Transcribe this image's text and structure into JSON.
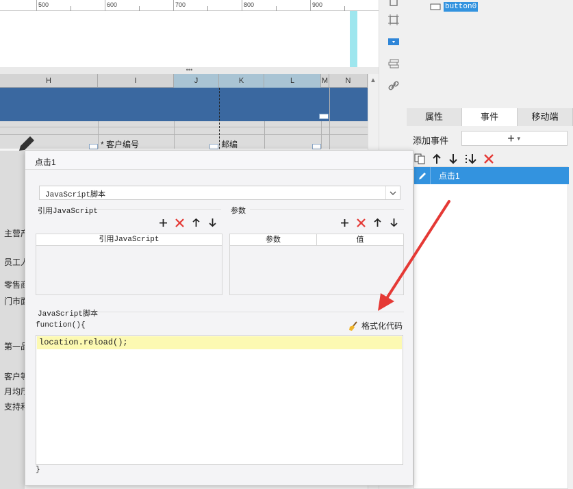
{
  "ruler": {
    "ticks": [
      "500",
      "600",
      "700",
      "800",
      "900"
    ]
  },
  "grid": {
    "columns": [
      "H",
      "I",
      "J",
      "K",
      "L",
      "M",
      "N"
    ],
    "cells": {
      "customer_no": "* 客户编号",
      "postcode": "邮编"
    },
    "row_labels": [
      "主营产",
      "员工人",
      "零售商",
      "门市面",
      "第一品",
      "客户等",
      "月均厅",
      "支持和"
    ]
  },
  "component_tree": {
    "item_label": "button0"
  },
  "panel_tabs": [
    "属性",
    "事件",
    "移动端"
  ],
  "events": {
    "add_label": "添加事件",
    "add_button_symbol": "+",
    "items": [
      "点击1"
    ]
  },
  "dialog": {
    "title": "点击1",
    "script_type": "JavaScript脚本",
    "ref_js_section": "引用JavaScript",
    "params_section": "参数",
    "ref_js_column": "引用JavaScript",
    "param_columns": [
      "参数",
      "值"
    ],
    "js_section": "JavaScript脚本",
    "function_header": "function(){",
    "format_label": "格式化代码",
    "code": "location.reload();",
    "function_footer": "}"
  },
  "colors": {
    "selection_blue": "#3393df",
    "band_blue": "#3a68a0",
    "delete_red": "#e53935",
    "code_highlight": "#fcf9b2",
    "arrow_red": "#e53935"
  }
}
